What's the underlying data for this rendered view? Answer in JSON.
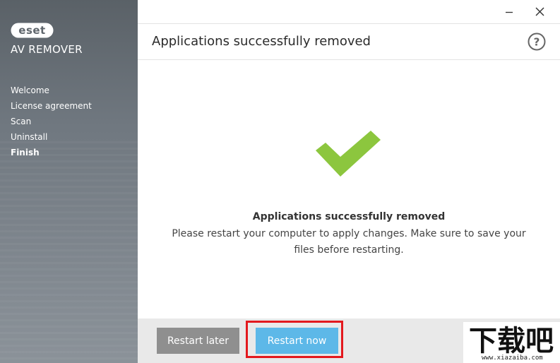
{
  "brand": {
    "logo_text": "eset",
    "product_name": "AV REMOVER"
  },
  "sidebar": {
    "items": [
      {
        "label": "Welcome",
        "active": false
      },
      {
        "label": "License agreement",
        "active": false
      },
      {
        "label": "Scan",
        "active": false
      },
      {
        "label": "Uninstall",
        "active": false
      },
      {
        "label": "Finish",
        "active": true
      }
    ]
  },
  "window_controls": {
    "minimize_icon": "minimize-icon",
    "close_icon": "close-icon"
  },
  "header": {
    "title": "Applications successfully removed",
    "help_icon": "help-icon"
  },
  "main": {
    "status_icon": "checkmark-icon",
    "message_title": "Applications successfully removed",
    "message_body": "Please restart your computer to apply changes. Make sure to save your files before restarting."
  },
  "footer": {
    "restart_later_label": "Restart later",
    "restart_now_label": "Restart now"
  },
  "watermark": {
    "logo_text": "下载吧",
    "url": "www.xiazaiba.com"
  },
  "colors": {
    "accent_blue": "#5db8e8",
    "check_green": "#8cc63e",
    "highlight_red": "#e3191e",
    "button_gray": "#8f8f8f"
  }
}
